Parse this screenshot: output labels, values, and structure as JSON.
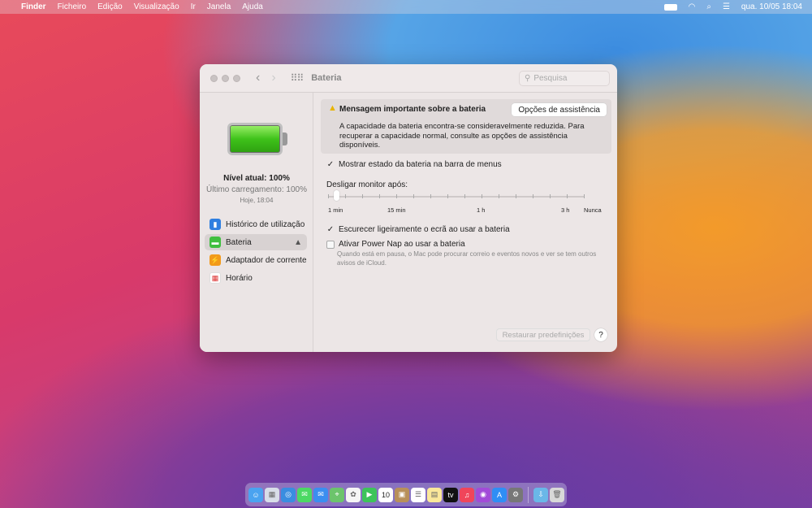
{
  "menubar": {
    "apple": "",
    "items": [
      "Finder",
      "Ficheiro",
      "Edição",
      "Visualização",
      "Ir",
      "Janela",
      "Ajuda"
    ],
    "clock": "qua. 10/05  18:04"
  },
  "window": {
    "title": "Bateria",
    "search_placeholder": "Pesquisa"
  },
  "sidebar": {
    "level": "Nível atual: 100%",
    "last_charge": "Último carregamento: 100%",
    "date": "Hoje, 18:04",
    "items": [
      {
        "label": "Histórico de utilização",
        "icon": "chart-icon",
        "color": "#2f7fe0"
      },
      {
        "label": "Bateria",
        "icon": "battery-icon",
        "color": "#3fbf3f"
      },
      {
        "label": "Adaptador de corrente",
        "icon": "bolt-icon",
        "color": "#f29a1a"
      },
      {
        "label": "Horário",
        "icon": "calendar-icon",
        "color": "#ffffff"
      }
    ]
  },
  "alert": {
    "title": "Mensagem importante sobre a bateria",
    "button": "Opções de assistência",
    "body": "A capacidade da bateria encontra-se consideravelmente reduzida. Para recuperar a capacidade normal, consulte as opções de assistência disponíveis."
  },
  "options": {
    "show_status": "Mostrar estado da bateria na barra de menus",
    "show_status_checked": true,
    "display_off_label": "Desligar monitor após:",
    "slider_value": "1 min",
    "slider_labels": [
      "1 min",
      "15 min",
      "1 h",
      "3 h",
      "Nunca"
    ],
    "dim": "Escurecer ligeiramente o ecrã ao usar a bateria",
    "dim_checked": true,
    "power_nap": "Ativar Power Nap ao usar a bateria",
    "power_nap_checked": false,
    "power_nap_note": "Quando está em pausa, o Mac pode procurar correio e eventos novos e ver se tem outros avisos de iCloud."
  },
  "footer": {
    "restore": "Restaurar predefinições",
    "help": "?"
  },
  "dock": {
    "apps": [
      "Finder",
      "Launchpad",
      "Safari",
      "Mensagens",
      "Mail",
      "Mapas",
      "Fotografias",
      "FaceTime",
      "Calendário",
      "Contactos",
      "Lembretes",
      "Notas",
      "TV",
      "Música",
      "Podcasts",
      "App Store",
      "Preferências do Sistema",
      "Transferências",
      "Lixo"
    ],
    "calendar_day": "10"
  }
}
